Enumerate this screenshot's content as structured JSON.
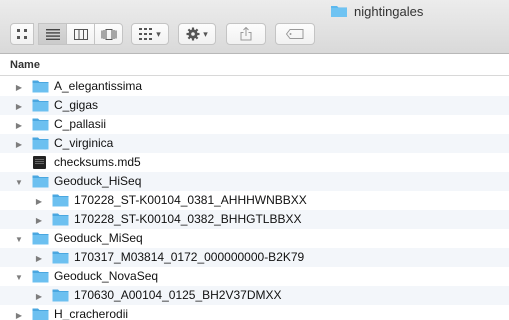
{
  "window": {
    "title": "nightingales"
  },
  "toolbar": {
    "view_buttons": [
      {
        "name": "icon-view-button",
        "icon": "grid-icon",
        "active": false
      },
      {
        "name": "list-view-button",
        "icon": "list-icon",
        "active": true
      },
      {
        "name": "column-view-button",
        "icon": "columns-icon",
        "active": false
      },
      {
        "name": "cover-flow-button",
        "icon": "cover-flow-icon",
        "active": false
      }
    ],
    "arrange_icon": "arrange-grid-icon",
    "action_icon": "gear-icon",
    "share_icon": "share-icon",
    "tag_icon": "tag-icon"
  },
  "list": {
    "column_header": "Name",
    "items": [
      {
        "label": "A_elegantissima",
        "type": "folder",
        "level": 0,
        "expanded": false
      },
      {
        "label": "C_gigas",
        "type": "folder",
        "level": 0,
        "expanded": false
      },
      {
        "label": "C_pallasii",
        "type": "folder",
        "level": 0,
        "expanded": false
      },
      {
        "label": "C_virginica",
        "type": "folder",
        "level": 0,
        "expanded": false
      },
      {
        "label": "checksums.md5",
        "type": "file",
        "level": 0
      },
      {
        "label": "Geoduck_HiSeq",
        "type": "folder",
        "level": 0,
        "expanded": true
      },
      {
        "label": "170228_ST-K00104_0381_AHHHWNBBXX",
        "type": "folder",
        "level": 1,
        "expanded": false
      },
      {
        "label": "170228_ST-K00104_0382_BHHGTLBBXX",
        "type": "folder",
        "level": 1,
        "expanded": false
      },
      {
        "label": "Geoduck_MiSeq",
        "type": "folder",
        "level": 0,
        "expanded": true
      },
      {
        "label": "170317_M03814_0172_000000000-B2K79",
        "type": "folder",
        "level": 1,
        "expanded": false
      },
      {
        "label": "Geoduck_NovaSeq",
        "type": "folder",
        "level": 0,
        "expanded": true
      },
      {
        "label": "170630_A00104_0125_BH2V37DMXX",
        "type": "folder",
        "level": 1,
        "expanded": false
      },
      {
        "label": "H_cracherodii",
        "type": "folder",
        "level": 0,
        "expanded": false
      }
    ]
  },
  "colors": {
    "folder": "#5cb8ee",
    "folder_tab": "#4aa7e0"
  }
}
